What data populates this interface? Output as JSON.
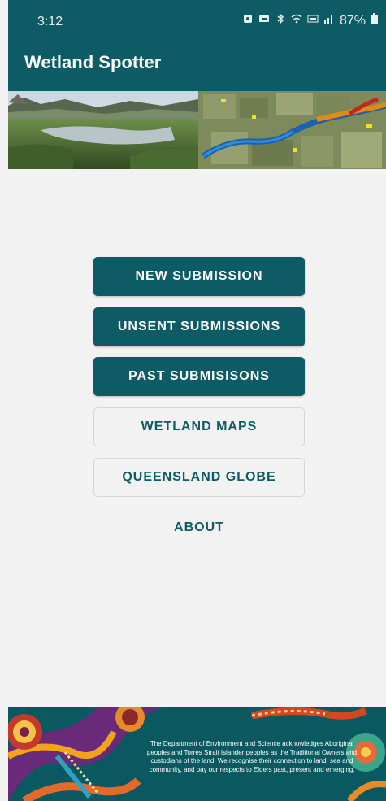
{
  "status_bar": {
    "time": "3:12",
    "battery": "87%",
    "icons": [
      "notification-icon",
      "do-not-disturb-icon",
      "bluetooth-icon",
      "wifi-icon",
      "volte-icon",
      "signal-icon",
      "battery-icon"
    ]
  },
  "app_bar": {
    "title": "Wetland Spotter"
  },
  "menu": {
    "new_submission": "NEW SUBMISSION",
    "unsent_submissions": "UNSENT SUBMISSIONS",
    "past_submissions": "PAST SUBMISISONS",
    "wetland_maps": "WETLAND MAPS",
    "queensland_globe": "QUEENSLAND GLOBE",
    "about": "ABOUT"
  },
  "footer": {
    "acknowledgement": "The Department of Environment and Science acknowledges Aboriginal peoples and Torres Strait Islander peoples as the Traditional Owners and custodians of the land. We recognise their connection to land, sea and community, and pay our respects to Elders past, present and emerging."
  },
  "colors": {
    "primary": "#0d5b64",
    "background": "#f2f2f2",
    "outline": "#d6d6d6"
  }
}
